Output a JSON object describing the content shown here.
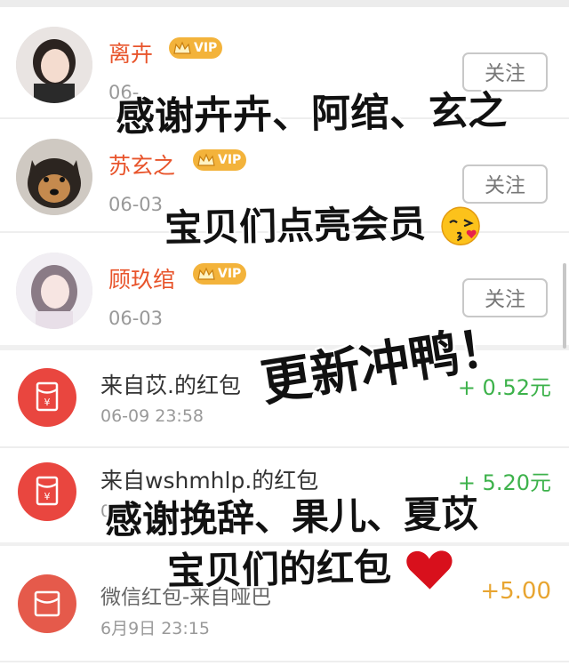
{
  "follows": [
    {
      "name": "离卉",
      "vip": "VIP",
      "date": "06-",
      "button": "关注"
    },
    {
      "name": "苏玄之",
      "vip": "VIP",
      "date": "06-03",
      "button": "关注"
    },
    {
      "name": "顾玖绾",
      "vip": "VIP",
      "date": "06-03",
      "button": "关注"
    }
  ],
  "packets": [
    {
      "title": "来自苡.的红包",
      "time": "06-09 23:58",
      "amount": "+ 0.52元"
    },
    {
      "title": "来自wshmhlp.的红包",
      "time": "06",
      "amount": "+ 5.20元"
    },
    {
      "title": "微信红包-来自哑巴",
      "time": "6月9日 23:15",
      "amount": "+5.00"
    }
  ],
  "overlay": {
    "line1": "感谢卉卉、阿绾、玄之",
    "line2": "宝贝们点亮会员",
    "line3": "更新冲鸭！",
    "line4": "感谢挽辞、果儿、夏苡",
    "line5": "宝贝们的红包"
  },
  "colors": {
    "name": "#e8542b",
    "vip": "#f3b33b",
    "packet": "#e9463f",
    "amount_green": "#3db24b",
    "amount_gold": "#e8a531"
  },
  "icons": [
    "crown-icon",
    "red-packet-icon",
    "kiss-emoji",
    "heart-emoji"
  ]
}
